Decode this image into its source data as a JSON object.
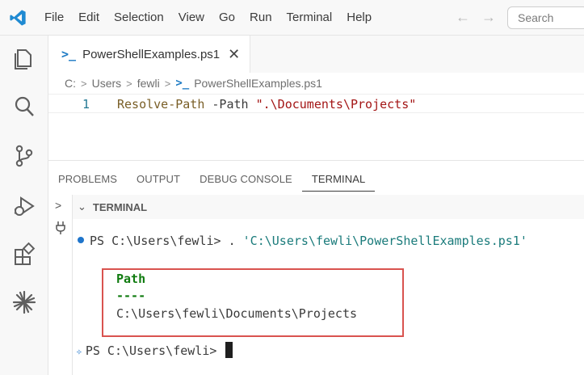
{
  "menu": [
    "File",
    "Edit",
    "Selection",
    "View",
    "Go",
    "Run",
    "Terminal",
    "Help"
  ],
  "search": {
    "placeholder": "Search"
  },
  "tab": {
    "label": "PowerShellExamples.ps1"
  },
  "breadcrumb": [
    "C:",
    "Users",
    "fewli",
    "PowerShellExamples.ps1"
  ],
  "editor": {
    "line_number": "1",
    "command": "Resolve-Path",
    "parameter": "-Path",
    "string": "\".\\Documents\\Projects\""
  },
  "panel": {
    "tabs": [
      "PROBLEMS",
      "OUTPUT",
      "DEBUG CONSOLE",
      "TERMINAL"
    ],
    "active_tab": "TERMINAL",
    "section_title": "TERMINAL"
  },
  "terminal": {
    "prompt1": "PS C:\\Users\\fewli> ",
    "cmd1_dot": ". ",
    "cmd1_str": "'C:\\Users\\fewli\\PowerShellExamples.ps1'",
    "output_header": "Path",
    "output_divider": "----",
    "output_value": "C:\\Users\\fewli\\Documents\\Projects",
    "prompt2": "PS C:\\Users\\fewli> "
  },
  "colors": {
    "accent": "#1f75cb",
    "highlight_border": "#d9534f",
    "string": "#a31515",
    "output_green": "#0f7b0f"
  }
}
